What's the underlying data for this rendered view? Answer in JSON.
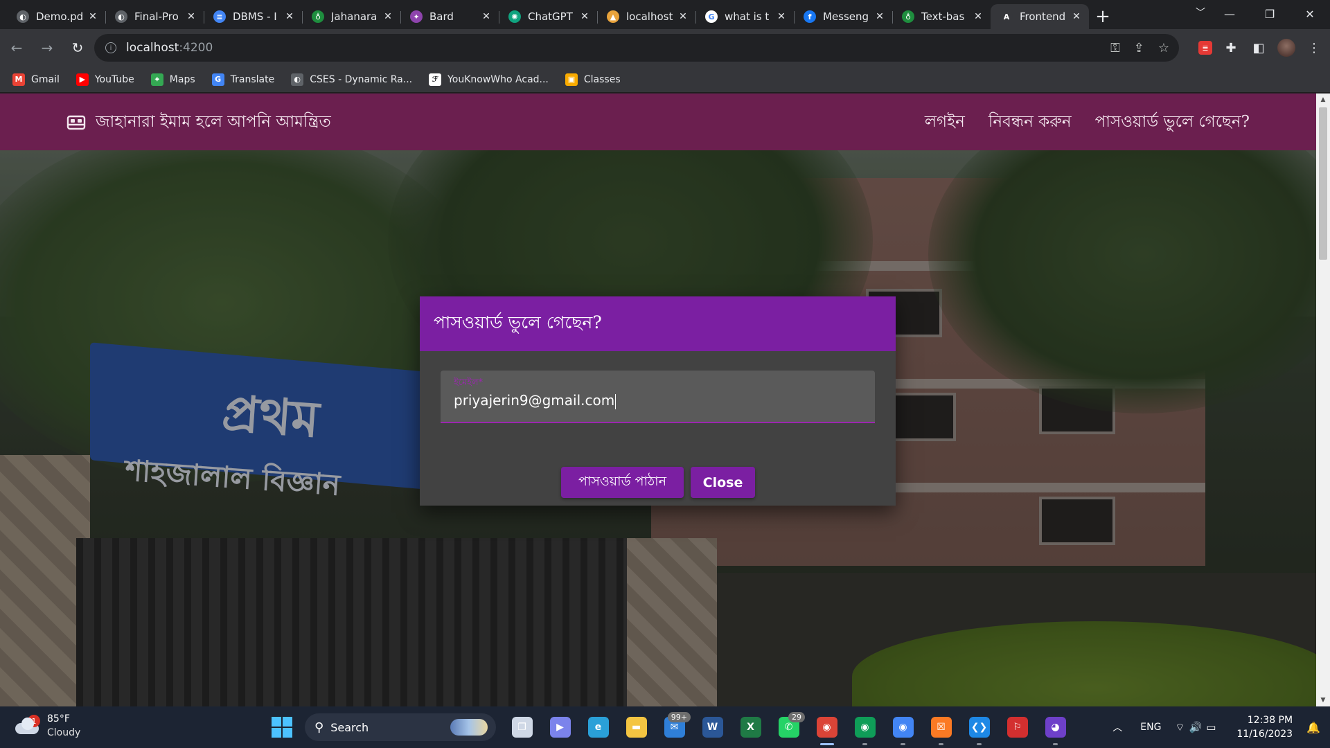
{
  "browser": {
    "tabs": [
      {
        "title": "Demo.pd",
        "icon": "globe-icon",
        "color": "#5f6368",
        "glyph": "◐"
      },
      {
        "title": "Final-Pro",
        "icon": "globe-icon",
        "color": "#5f6368",
        "glyph": "◐"
      },
      {
        "title": "DBMS - I",
        "icon": "docs-icon",
        "color": "#4285f4",
        "glyph": "≡"
      },
      {
        "title": "Jahanara",
        "icon": "leaf-icon",
        "color": "#1e8e3e",
        "glyph": "♁"
      },
      {
        "title": "Bard",
        "icon": "bard-icon",
        "color": "#8e44ad",
        "glyph": "✦"
      },
      {
        "title": "ChatGPT",
        "icon": "chatgpt-icon",
        "color": "#10a37f",
        "glyph": "✺"
      },
      {
        "title": "localhost",
        "icon": "mountain-icon",
        "color": "#e8a33c",
        "glyph": "▲"
      },
      {
        "title": "what is t",
        "icon": "google-icon",
        "color": "#ffffff",
        "glyph": "G"
      },
      {
        "title": "Messeng",
        "icon": "facebook-icon",
        "color": "#1877f2",
        "glyph": "f"
      },
      {
        "title": "Text-bas",
        "icon": "leaf-icon",
        "color": "#1e8e3e",
        "glyph": "♁"
      },
      {
        "title": "Frontend",
        "icon": "angular-icon",
        "color": "#35363a",
        "glyph": "A"
      }
    ],
    "active_tab_index": 10,
    "address": {
      "host": "localhost",
      "port": ":4200"
    },
    "bookmarks": [
      {
        "label": "Gmail",
        "icon": "gmail-icon",
        "color": "#ea4335",
        "glyph": "M"
      },
      {
        "label": "YouTube",
        "icon": "youtube-icon",
        "color": "#ff0000",
        "glyph": "▶"
      },
      {
        "label": "Maps",
        "icon": "maps-icon",
        "color": "#34a853",
        "glyph": "⌖"
      },
      {
        "label": "Translate",
        "icon": "translate-icon",
        "color": "#4285f4",
        "glyph": "G"
      },
      {
        "label": "CSES - Dynamic Ra...",
        "icon": "globe-icon",
        "color": "#5f6368",
        "glyph": "◐"
      },
      {
        "label": "YouKnowWho Acad...",
        "icon": "ykw-icon",
        "color": "#ffffff",
        "glyph": "ℱ"
      },
      {
        "label": "Classes",
        "icon": "classroom-icon",
        "color": "#f9ab00",
        "glyph": "▣"
      }
    ]
  },
  "app": {
    "brand": "জাহানারা ইমাম হলে আপনি আমন্ত্রিত",
    "nav": [
      "লগইন",
      "নিবন্ধন করুন",
      "পাসওয়ার্ড ভুলে গেছেন?"
    ],
    "colors": {
      "appbar": "#6b1f4f",
      "accent": "#7b1fa2"
    }
  },
  "background_sign": {
    "line1": "প্রথম",
    "line2": "শাহজালাল বিজ্ঞান"
  },
  "dialog": {
    "title": "পাসওয়ার্ড ভুলে গেছেন?",
    "email_label": "ইমেইল*",
    "email_value": "priyajerin9@gmail.com",
    "send_button": "পাসওয়ার্ড পাঠান",
    "close_button": "Close"
  },
  "taskbar": {
    "weather": {
      "temp": "85°F",
      "condition": "Cloudy",
      "badge": "1"
    },
    "search_label": "Search",
    "apps": [
      {
        "name": "task-view-icon",
        "color": "#cfd8e6",
        "glyph": "❐"
      },
      {
        "name": "teams-icon",
        "color": "#7b83eb",
        "glyph": "▶"
      },
      {
        "name": "edge-icon",
        "color": "#2aa0d8",
        "glyph": "e"
      },
      {
        "name": "file-explorer-icon",
        "color": "#f4c542",
        "glyph": "▬"
      },
      {
        "name": "mail-icon",
        "color": "#2f7fd8",
        "glyph": "✉",
        "count": "99+"
      },
      {
        "name": "word-icon",
        "color": "#2b5797",
        "glyph": "W"
      },
      {
        "name": "excel-icon",
        "color": "#1f7a45",
        "glyph": "X"
      },
      {
        "name": "whatsapp-icon",
        "color": "#25d366",
        "glyph": "✆",
        "count": "29"
      },
      {
        "name": "chrome-icon",
        "color": "#db4437",
        "glyph": "◉",
        "state": "active"
      },
      {
        "name": "chrome-icon",
        "color": "#0f9d58",
        "glyph": "◉",
        "state": "running"
      },
      {
        "name": "chrome-icon",
        "color": "#4285f4",
        "glyph": "◉",
        "state": "running"
      },
      {
        "name": "xampp-icon",
        "color": "#fb7a24",
        "glyph": "☒",
        "state": "running"
      },
      {
        "name": "vscode-icon",
        "color": "#1e88e5",
        "glyph": "❮❯",
        "state": "running"
      },
      {
        "name": "acrobat-icon",
        "color": "#d32f2f",
        "glyph": "⚐"
      },
      {
        "name": "github-icon",
        "color": "#6e40c9",
        "glyph": "◕",
        "state": "running"
      }
    ],
    "language": "ENG",
    "time": "12:38 PM",
    "date": "11/16/2023"
  }
}
